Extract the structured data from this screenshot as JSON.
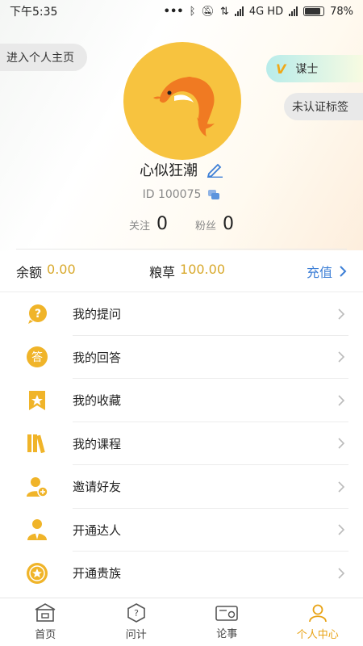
{
  "status_bar": {
    "time": "下午5:35",
    "network": "4G HD",
    "battery": "78%"
  },
  "profile": {
    "enter_homepage": "进入个人主页",
    "tag_title": "谋士",
    "tag_unverified": "未认证标签",
    "nickname": "心似狂潮",
    "id_text": "ID 100075",
    "follow_label": "关注",
    "follow_count": "0",
    "fans_label": "粉丝",
    "fans_count": "0"
  },
  "balance": {
    "balance_label": "余额",
    "balance_value": "0.00",
    "grain_label": "粮草",
    "grain_value": "100.00",
    "recharge_label": "充值"
  },
  "menu": {
    "items": [
      {
        "label": "我的提问",
        "icon": "question-icon"
      },
      {
        "label": "我的回答",
        "icon": "answer-icon"
      },
      {
        "label": "我的收藏",
        "icon": "bookmark-icon"
      },
      {
        "label": "我的课程",
        "icon": "books-icon"
      },
      {
        "label": "邀请好友",
        "icon": "invite-friend-icon"
      },
      {
        "label": "开通达人",
        "icon": "expert-icon"
      },
      {
        "label": "开通贵族",
        "icon": "noble-icon"
      }
    ]
  },
  "tabbar": {
    "tabs": [
      {
        "label": "首页",
        "icon": "home-icon"
      },
      {
        "label": "问计",
        "icon": "ask-icon"
      },
      {
        "label": "论事",
        "icon": "discuss-icon"
      },
      {
        "label": "个人中心",
        "icon": "profile-icon"
      }
    ],
    "active": "个人中心"
  },
  "colors": {
    "accent": "#f0b429",
    "avatar_bg": "#f7c33f",
    "link": "#3d7fd6",
    "value_gold": "#d8a82a"
  }
}
